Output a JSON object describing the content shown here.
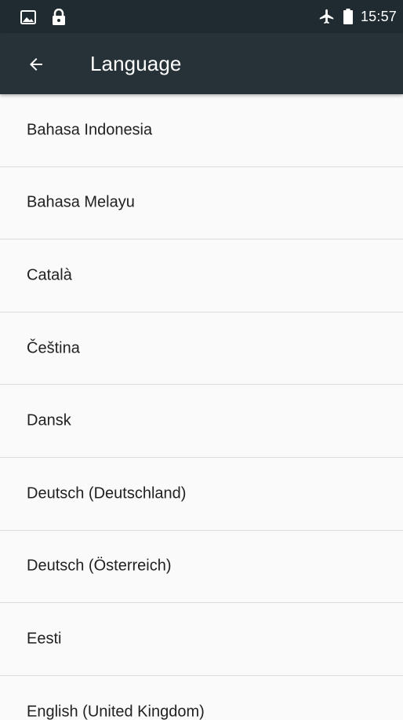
{
  "status_bar": {
    "time": "15:57",
    "icons": [
      "image-icon",
      "lock-icon",
      "airplane-icon",
      "battery-icon"
    ]
  },
  "toolbar": {
    "title": "Language",
    "back_icon": "arrow-left-icon"
  },
  "languages": [
    {
      "label": "Bahasa Indonesia"
    },
    {
      "label": "Bahasa Melayu"
    },
    {
      "label": "Català"
    },
    {
      "label": "Čeština"
    },
    {
      "label": "Dansk"
    },
    {
      "label": "Deutsch (Deutschland)"
    },
    {
      "label": "Deutsch (Österreich)"
    },
    {
      "label": "Eesti"
    },
    {
      "label": "English (United Kingdom)"
    }
  ],
  "colors": {
    "status_bar_bg": "#1f2b31",
    "toolbar_bg": "#263238",
    "list_bg": "#fafafa",
    "divider": "#dcdcdc",
    "text_primary": "#212121",
    "toolbar_text": "#ffffff"
  }
}
